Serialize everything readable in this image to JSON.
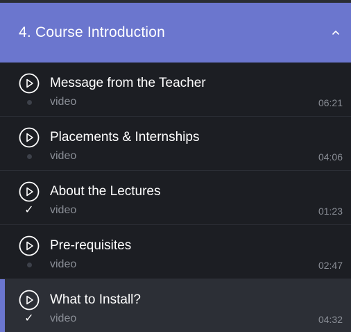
{
  "section": {
    "title": "4. Course Introduction",
    "collapse_icon": "chevron-up-icon",
    "accent_color": "#6b76ce"
  },
  "lectures": [
    {
      "title": "Message from the Teacher",
      "type": "video",
      "duration": "06:21",
      "completed": false,
      "active": false
    },
    {
      "title": "Placements & Internships",
      "type": "video",
      "duration": "04:06",
      "completed": false,
      "active": false
    },
    {
      "title": "About the Lectures",
      "type": "video",
      "duration": "01:23",
      "completed": true,
      "active": false
    },
    {
      "title": "Pre-requisites",
      "type": "video",
      "duration": "02:47",
      "completed": false,
      "active": false
    },
    {
      "title": "What to Install?",
      "type": "video",
      "duration": "04:32",
      "completed": true,
      "active": true
    }
  ],
  "icons": {
    "play": "play-circle-icon",
    "completed": "checkmark-icon",
    "incomplete": "dot-icon"
  },
  "check_glyph": "✓"
}
